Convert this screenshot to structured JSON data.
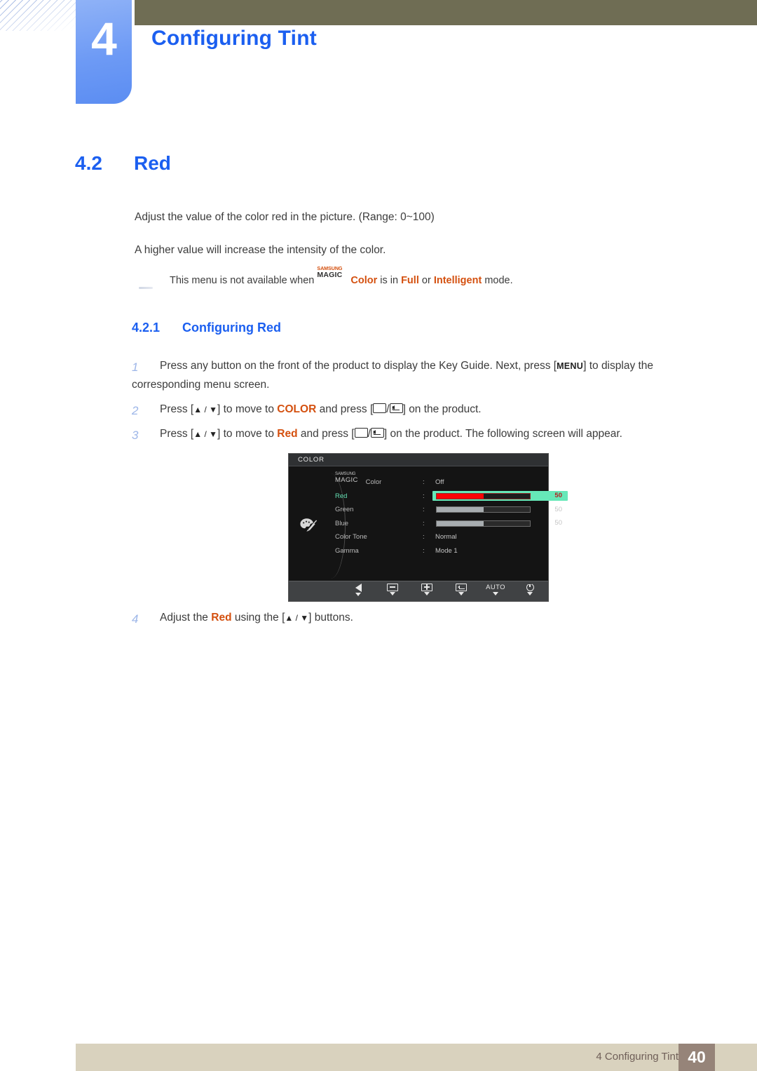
{
  "chapter": {
    "number": "4",
    "title": "Configuring Tint"
  },
  "section": {
    "number": "4.2",
    "title": "Red"
  },
  "paragraphs": {
    "p1": "Adjust the value of the color red in the picture. (Range: 0~100)",
    "p2": "A higher value will increase the intensity of the color."
  },
  "note": {
    "before": "This menu is not available when ",
    "magic_top": "SAMSUNG",
    "magic_bottom": "MAGIC",
    "magic_color": "Color",
    "middle": " is in ",
    "mode1": "Full",
    "or": " or ",
    "mode2": "Intelligent",
    "after": " mode."
  },
  "subsection": {
    "number": "4.2.1",
    "title": "Configuring Red"
  },
  "steps": [
    {
      "n": "1",
      "t1": "Press any button on the front of the product to display the Key Guide. Next, press [",
      "kbd": "MENU",
      "t2": "] to display the corresponding menu screen."
    },
    {
      "n": "2",
      "t1": "Press [",
      "arrows": "▲ / ▼",
      "t2": "] to move to ",
      "hl": "COLOR",
      "t3": " and press [",
      "t4": "] on the product."
    },
    {
      "n": "3",
      "t1": "Press [",
      "arrows": "▲ / ▼",
      "t2": "] to move to ",
      "hl": "Red",
      "t3": " and press [",
      "t4": "] on the product. The following screen will appear."
    },
    {
      "n": "4",
      "t1": "Adjust the ",
      "hl": "Red",
      "t2": " using the [",
      "arrows": "▲ / ▼",
      "t3": "] buttons."
    }
  ],
  "osd": {
    "title": "COLOR",
    "rows": [
      {
        "label_magic_top": "SAMSUNG",
        "label_magic_bottom": "MAGIC",
        "label_suffix": " Color",
        "colon": ":",
        "type": "text",
        "value": "Off",
        "selected": false
      },
      {
        "label": "Red",
        "colon": ":",
        "type": "slider",
        "value": "50",
        "fill_percent": 50,
        "selected": true
      },
      {
        "label": "Green",
        "colon": ":",
        "type": "slider",
        "value": "50",
        "fill_percent": 50,
        "selected": false
      },
      {
        "label": "Blue",
        "colon": ":",
        "type": "slider",
        "value": "50",
        "fill_percent": 50,
        "selected": false
      },
      {
        "label": "Color Tone",
        "colon": ":",
        "type": "text",
        "value": "Normal",
        "selected": false
      },
      {
        "label": "Gamma",
        "colon": ":",
        "type": "text",
        "value": "Mode 1",
        "selected": false
      }
    ],
    "buttons": [
      {
        "icon": "left-arrow-icon",
        "label": ""
      },
      {
        "icon": "minus-icon",
        "label": ""
      },
      {
        "icon": "plus-icon",
        "label": ""
      },
      {
        "icon": "enter-icon",
        "label": ""
      },
      {
        "icon": "auto-icon",
        "label": "AUTO"
      },
      {
        "icon": "power-icon",
        "label": ""
      }
    ]
  },
  "footer": {
    "text": "4 Configuring Tint",
    "page": "40"
  },
  "colors": {
    "accent_blue": "#1b5ff0",
    "tab_blue": "#6d9af5",
    "olive": "#6f6d54",
    "orange": "#d4500f",
    "footer_bar": "#d9d2be",
    "footer_page": "#968479",
    "osd_highlight": "#66e8b8",
    "osd_red": "#fa0505"
  }
}
